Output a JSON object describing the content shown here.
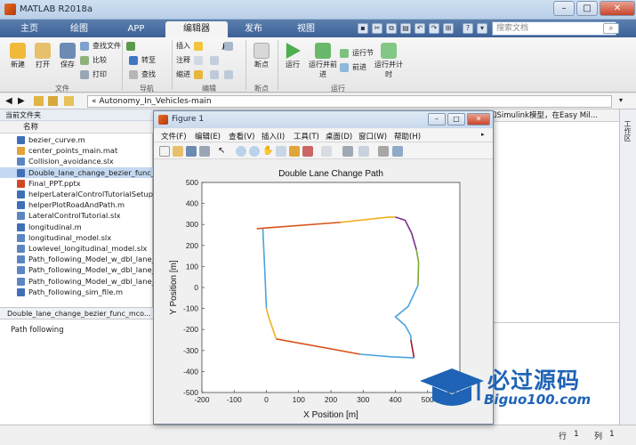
{
  "window": {
    "title": "MATLAB R2018a"
  },
  "tabs": [
    {
      "label": "主页"
    },
    {
      "label": "绘图"
    },
    {
      "label": "APP"
    },
    {
      "label": "编辑器"
    },
    {
      "label": "发布"
    },
    {
      "label": "视图"
    }
  ],
  "search": {
    "placeholder": "搜索文档",
    "login": "登录"
  },
  "ribbon": {
    "file_group": {
      "label": "文件",
      "new": "新建",
      "open": "打开",
      "save": "保存",
      "find_files": "查找文件",
      "compare": "比较",
      "print": "打印"
    },
    "nav_group": {
      "label": "导航",
      "goto": "转至",
      "find": "查找"
    },
    "edit_group": {
      "label": "编辑",
      "insert": "插入",
      "comment": "注释",
      "indent": "缩进",
      "fx": "fx"
    },
    "breakpoint_group": {
      "label": "断点",
      "breakpoints": "断点"
    },
    "run_group": {
      "label": "运行",
      "run": "运行",
      "run_advance": "运行并前进",
      "run_section": "运行节",
      "advance": "前进",
      "run_time": "运行并计时"
    }
  },
  "address": {
    "path": "« Autonomy_In_Vehicles-main"
  },
  "folder_panel": {
    "title": "当前文件夹",
    "name_header": "名称",
    "files": [
      {
        "name": "bezier_curve.m",
        "kind": "m"
      },
      {
        "name": "center_points_main.mat",
        "kind": "mat"
      },
      {
        "name": "Collision_avoidance.slx",
        "kind": "slx"
      },
      {
        "name": "Double_lane_change_bezier_func_...",
        "kind": "m",
        "selected": true
      },
      {
        "name": "Final_PPT.pptx",
        "kind": "pptx"
      },
      {
        "name": "helperLateralControlTutorialSetup...",
        "kind": "m"
      },
      {
        "name": "helperPlotRoadAndPath.m",
        "kind": "m"
      },
      {
        "name": "LateralControlTutorial.slx",
        "kind": "slx"
      },
      {
        "name": "longitudinal.m",
        "kind": "m"
      },
      {
        "name": "longitudinal_model.slx",
        "kind": "slx"
      },
      {
        "name": "Lowlevel_longitudinal_model.slx",
        "kind": "slx"
      },
      {
        "name": "Path_following_Model_w_dbl_lane_...",
        "kind": "slx"
      },
      {
        "name": "Path_following_Model_w_dbl_lane_...",
        "kind": "slx"
      },
      {
        "name": "Path_following_Model_w_dbl_lane_...",
        "kind": "slx"
      },
      {
        "name": "Path_following_sim_file.m",
        "kind": "m"
      }
    ]
  },
  "details": {
    "header": "Double_lane_change_bezier_func_mco...",
    "text": "Path following"
  },
  "editor": {
    "tab_text": "和Simulink模型，在Easy Mil..."
  },
  "workspace": {
    "label": "工作区"
  },
  "status": {
    "row_label": "行",
    "row": "1",
    "col_label": "列",
    "col": "1"
  },
  "figure": {
    "title": "Figure 1",
    "menus": [
      "文件(F)",
      "编辑(E)",
      "查看(V)",
      "插入(I)",
      "工具(T)",
      "桌面(D)",
      "窗口(W)",
      "帮助(H)"
    ]
  },
  "colors": {
    "tab_bar": "#3d6196",
    "accent": "#1f63b6"
  },
  "watermark": {
    "title": "必过源码",
    "subtitle": "Biguo100.com"
  },
  "chart_data": {
    "type": "line",
    "title": "Double Lane Change Path",
    "xlabel": "X Position [m]",
    "ylabel": "Y Position [m]",
    "xlim": [
      -200,
      600
    ],
    "ylim": [
      -500,
      500
    ],
    "xticks": [
      -200,
      -100,
      0,
      100,
      200,
      300,
      400,
      500,
      600
    ],
    "yticks": [
      -500,
      -400,
      -300,
      -200,
      -100,
      0,
      100,
      200,
      300,
      400,
      500
    ],
    "grid": false,
    "series": [
      {
        "color": "#4aa3df",
        "x": [
          0,
          -5,
          -11
        ],
        "y": [
          -100,
          80,
          280
        ]
      },
      {
        "color": "#d95319",
        "x": [
          -30,
          230
        ],
        "y": [
          280,
          310
        ]
      },
      {
        "color": "#edb120",
        "x": [
          230,
          380,
          400
        ],
        "y": [
          310,
          335,
          335
        ]
      },
      {
        "color": "#7e2f8e",
        "x": [
          400,
          430,
          450,
          465
        ],
        "y": [
          335,
          320,
          260,
          180
        ]
      },
      {
        "color": "#77ac30",
        "x": [
          465,
          472,
          470
        ],
        "y": [
          180,
          120,
          10
        ]
      },
      {
        "color": "#4aa3df",
        "x": [
          470,
          440,
          400,
          430,
          448,
          448
        ],
        "y": [
          10,
          -90,
          -140,
          -180,
          -230,
          -250
        ]
      },
      {
        "color": "#a2142f",
        "x": [
          448,
          458
        ],
        "y": [
          -250,
          -335
        ]
      },
      {
        "color": "#4aa3df",
        "x": [
          458,
          390,
          290
        ],
        "y": [
          -335,
          -330,
          -318
        ]
      },
      {
        "color": "#d95319",
        "x": [
          290,
          30
        ],
        "y": [
          -318,
          -245
        ]
      },
      {
        "color": "#edb120",
        "x": [
          30,
          5,
          0
        ],
        "y": [
          -245,
          -130,
          -100
        ]
      }
    ]
  }
}
